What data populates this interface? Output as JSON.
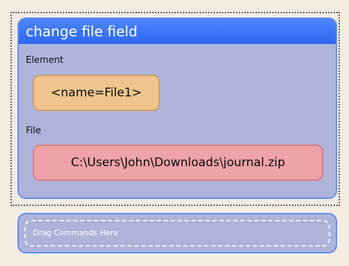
{
  "command": {
    "title": "change file field",
    "element_label": "Element",
    "element_value": "<name=File1>",
    "file_label": "File",
    "file_value": "C:\\Users\\John\\Downloads\\journal.zip"
  },
  "drop_zone": {
    "label": "Drag Commands Here"
  }
}
